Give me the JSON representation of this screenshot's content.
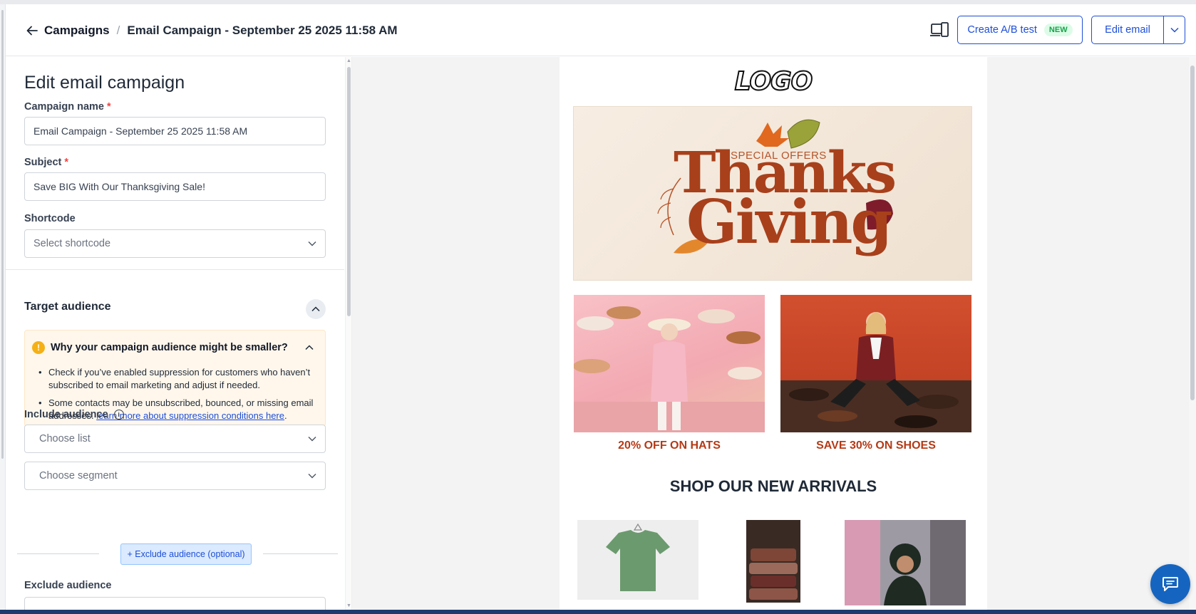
{
  "header": {
    "breadcrumb_root": "Campaigns",
    "breadcrumb_separator": "/",
    "breadcrumb_current": "Email Campaign - September 25 2025 11:58 AM",
    "ab_test_label": "Create A/B test",
    "ab_test_badge": "NEW",
    "edit_email_label": "Edit email"
  },
  "sidebar": {
    "title": "Edit email campaign",
    "campaign_name_label": "Campaign name",
    "campaign_name_value": "Email Campaign - September 25 2025 11:58 AM",
    "subject_label": "Subject",
    "subject_value": "Save BIG With Our Thanksgiving Sale!",
    "required_mark": "*",
    "shortcode_label": "Shortcode",
    "shortcode_placeholder": "Select shortcode",
    "target_audience_title": "Target audience",
    "notice": {
      "title": "Why your campaign audience might be smaller?",
      "item_1": "Check if you’ve enabled suppression for customers who haven’t subscribed to email marketing and adjust if needed.",
      "item_2_text": "Some contacts may be unsubscribed, bounced, or missing email addresses.",
      "item_2_link": "learn more about suppression conditions here",
      "item_2_end": "."
    },
    "include_audience_label": "Include audience",
    "choose_list_placeholder": "Choose list",
    "choose_segment_placeholder": "Choose segment",
    "exclude_button_label": "+ Exclude audience (optional)",
    "exclude_audience_label": "Exclude audience"
  },
  "preview": {
    "logo_text": "LOGO",
    "hero_special": "SPECIAL OFFERS",
    "hero_line_1": "Thanks",
    "hero_line_2": "Giving",
    "promo_1": "20% OFF ON HATS",
    "promo_2": "SAVE 30% ON SHOES",
    "arrivals_title": "SHOP OUR NEW ARRIVALS"
  },
  "colors": {
    "accent": "#1d4ed8",
    "promo_text": "#b53a16",
    "notice_bg": "#fff7ec",
    "warning": "#f5b015",
    "chat_fab": "#1565c0"
  },
  "icons": [
    "arrow-left-icon",
    "device-preview-icon",
    "chevron-down-icon",
    "chevron-up-icon",
    "warning-icon",
    "info-icon",
    "chat-icon"
  ]
}
